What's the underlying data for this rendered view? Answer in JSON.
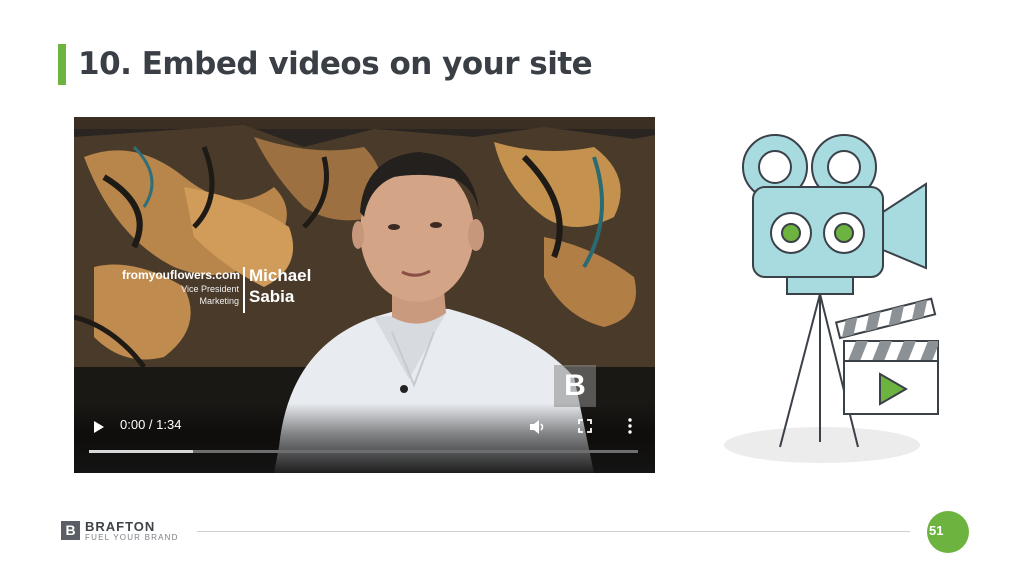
{
  "slide": {
    "title": "10. Embed videos on your site",
    "page_number": "51"
  },
  "video": {
    "lower_third": {
      "company": "fromyouflowers.com",
      "role_line1": "Vice President",
      "role_line2": "Marketing",
      "first_name": "Michael",
      "last_name": "Sabia"
    },
    "watermark": "B",
    "controls": {
      "time": "0:00 / 1:34",
      "play_icon": "play-icon",
      "volume_icon": "volume-icon",
      "fullscreen_icon": "fullscreen-icon",
      "more_icon": "more-options-icon",
      "buffered_fraction": 0.19
    }
  },
  "footer": {
    "logo_letter": "B",
    "brand": "BRAFTON",
    "tagline": "FUEL YOUR BRAND"
  },
  "colors": {
    "accent_green": "#6cb33f",
    "title_text": "#3a3f46",
    "camera_blue": "#a8dbe0",
    "outline": "#3b4148"
  }
}
